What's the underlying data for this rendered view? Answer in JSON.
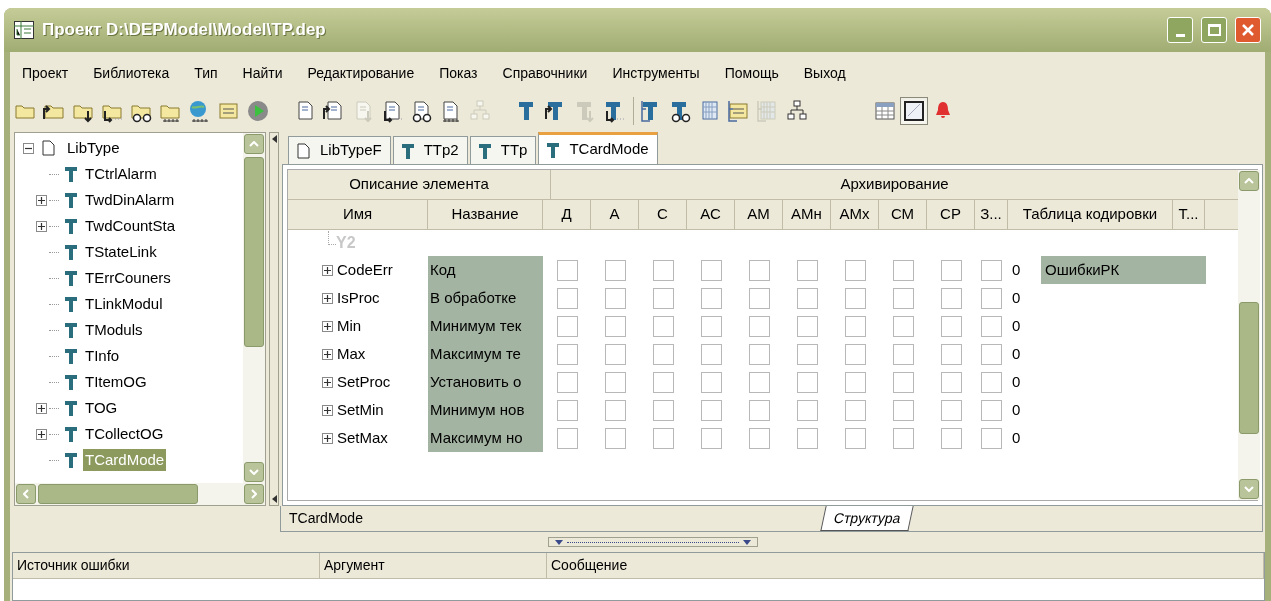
{
  "window": {
    "title": "Проект D:\\DEPModel\\Model\\TP.dep"
  },
  "menu": [
    "Проект",
    "Библиотека",
    "Тип",
    "Найти",
    "Редактирование",
    "Показ",
    "Справочники",
    "Инструменты",
    "Помощь",
    "Выход"
  ],
  "toolbar": [
    [
      {
        "kind": "folder",
        "disabled": false,
        "pressed": false
      },
      {
        "kind": "folder-up",
        "disabled": false,
        "pressed": false
      },
      {
        "kind": "folder-down",
        "disabled": false,
        "pressed": false
      },
      {
        "kind": "folder-branch",
        "disabled": false,
        "pressed": false
      },
      {
        "kind": "folder-view",
        "disabled": false,
        "pressed": false
      },
      {
        "kind": "folder-binary",
        "disabled": false,
        "pressed": false
      },
      {
        "kind": "globe-binary",
        "disabled": false,
        "pressed": false
      },
      {
        "kind": "list",
        "disabled": false,
        "pressed": false
      },
      {
        "kind": "play",
        "disabled": false,
        "pressed": false
      }
    ],
    [
      {
        "kind": "doc",
        "disabled": false,
        "pressed": false
      },
      {
        "kind": "doc-up",
        "disabled": false,
        "pressed": false
      },
      {
        "kind": "doc-down",
        "disabled": true,
        "pressed": false
      },
      {
        "kind": "doc-branch",
        "disabled": false,
        "pressed": false
      },
      {
        "kind": "doc-view",
        "disabled": false,
        "pressed": false
      },
      {
        "kind": "doc-binary",
        "disabled": false,
        "pressed": false
      },
      {
        "kind": "hierarchy",
        "disabled": true,
        "pressed": false
      }
    ],
    [
      {
        "kind": "type",
        "disabled": false,
        "pressed": false
      },
      {
        "kind": "type-up",
        "disabled": false,
        "pressed": false
      },
      {
        "kind": "type-down",
        "disabled": true,
        "pressed": false
      },
      {
        "kind": "type-branch",
        "disabled": false,
        "pressed": false
      }
    ],
    [
      {
        "kind": "type-tree",
        "disabled": false,
        "pressed": false
      },
      {
        "kind": "type-view",
        "disabled": false,
        "pressed": false
      },
      {
        "kind": "grid",
        "disabled": false,
        "pressed": false
      },
      {
        "kind": "list-tree",
        "disabled": false,
        "pressed": false
      },
      {
        "kind": "grid-tree",
        "disabled": true,
        "pressed": false
      },
      {
        "kind": "hierarchy",
        "disabled": false,
        "pressed": false
      }
    ],
    [
      {
        "kind": "table",
        "disabled": false,
        "pressed": false
      },
      {
        "kind": "frame",
        "disabled": false,
        "pressed": true
      },
      {
        "kind": "bell",
        "disabled": false,
        "pressed": false
      }
    ]
  ],
  "tree": {
    "label": "LibType",
    "expanded": true,
    "children": [
      {
        "label": "TCtrlAlarm",
        "selected": false
      },
      {
        "label": "TwdDinAlarm",
        "selected": false,
        "expanded": false
      },
      {
        "label": "TwdCountSta",
        "selected": false,
        "expanded": false
      },
      {
        "label": "TStateLink",
        "selected": false
      },
      {
        "label": "TErrCouners",
        "selected": false
      },
      {
        "label": "TLinkModul",
        "selected": false
      },
      {
        "label": "TModuls",
        "selected": false
      },
      {
        "label": "TInfo",
        "selected": false
      },
      {
        "label": "TItemOG",
        "selected": false
      },
      {
        "label": "TOG",
        "selected": false,
        "expanded": false
      },
      {
        "label": "TCollectOG",
        "selected": false,
        "expanded": false
      },
      {
        "label": "TCardMode",
        "selected": true
      }
    ]
  },
  "tabs": [
    {
      "label": "LibTypeF",
      "kind": "doc",
      "selected": false
    },
    {
      "label": "TTp2",
      "kind": "type",
      "selected": false
    },
    {
      "label": "TTp",
      "kind": "type",
      "selected": false
    },
    {
      "label": "TCardMode",
      "kind": "type",
      "selected": true
    }
  ],
  "table": {
    "groups": [
      "Описание элемента",
      "Архивирование"
    ],
    "columns": [
      "Имя",
      "Название",
      "Д",
      "А",
      "С",
      "АС",
      "АМ",
      "АМн",
      "АМх",
      "СМ",
      "СР",
      "З...",
      "Таблица кодировки",
      "Т..."
    ],
    "parent": "Y2",
    "rows": [
      {
        "name": "CodeErr",
        "title": "Код",
        "expanded": false,
        "flags": [
          false,
          false,
          false,
          false,
          false,
          false,
          false,
          false,
          false,
          false
        ],
        "value": "0",
        "coding": "ОшибкиРК"
      },
      {
        "name": "IsProc",
        "title": "В обработке",
        "expanded": false,
        "flags": [
          false,
          false,
          false,
          false,
          false,
          false,
          false,
          false,
          false,
          false
        ],
        "value": "0"
      },
      {
        "name": "Min",
        "title": "Минимум тек",
        "expanded": false,
        "flags": [
          false,
          false,
          false,
          false,
          false,
          false,
          false,
          false,
          false,
          false
        ],
        "value": "0"
      },
      {
        "name": "Max",
        "title": "Максимум те",
        "expanded": false,
        "flags": [
          false,
          false,
          false,
          false,
          false,
          false,
          false,
          false,
          false,
          false
        ],
        "value": "0"
      },
      {
        "name": "SetProc",
        "title": "Установить о",
        "expanded": false,
        "flags": [
          false,
          false,
          false,
          false,
          false,
          false,
          false,
          false,
          false,
          false
        ],
        "value": "0"
      },
      {
        "name": "SetMin",
        "title": "Минимум нов",
        "expanded": false,
        "flags": [
          false,
          false,
          false,
          false,
          false,
          false,
          false,
          false,
          false,
          false
        ],
        "value": "0"
      },
      {
        "name": "SetMax",
        "title": "Максимум но",
        "expanded": false,
        "flags": [
          false,
          false,
          false,
          false,
          false,
          false,
          false,
          false,
          false,
          false
        ],
        "value": "0"
      }
    ]
  },
  "editor_status": "TCardMode",
  "view_tabs": [
    {
      "label": "Структура",
      "selected": true
    }
  ],
  "errors": {
    "columns": [
      "Источник ошибки",
      "Аргумент",
      "Сообщение"
    ]
  }
}
